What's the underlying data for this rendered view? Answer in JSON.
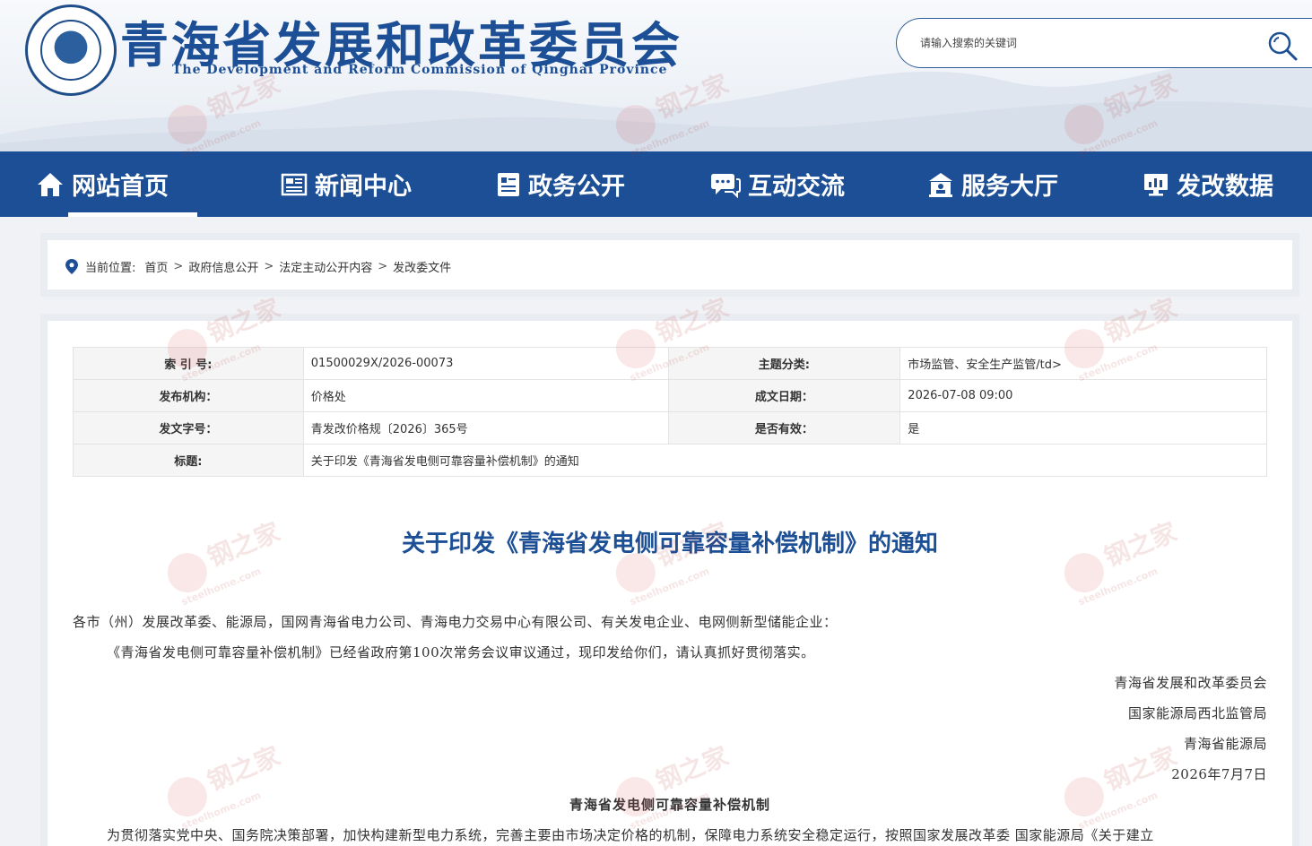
{
  "header": {
    "title": "青海省发展和改革委员会",
    "subtitle": "The Development and Reform Commission of Qinghai Province",
    "search_placeholder": "请输入搜索的关键词"
  },
  "nav": {
    "items": [
      {
        "label": "网站首页",
        "icon": "home-icon"
      },
      {
        "label": "新闻中心",
        "icon": "news-icon"
      },
      {
        "label": "政务公开",
        "icon": "document-icon"
      },
      {
        "label": "互动交流",
        "icon": "chat-icon"
      },
      {
        "label": "服务大厅",
        "icon": "service-icon"
      },
      {
        "label": "发改数据",
        "icon": "data-icon"
      }
    ],
    "active": "网站首页"
  },
  "breadcrumb": {
    "prefix": "当前位置:",
    "items": [
      "首页",
      "政府信息公开",
      "法定主动公开内容",
      "发改委文件"
    ],
    "separator": ">"
  },
  "meta": {
    "index_label": "索 引 号:",
    "index_value": "01500029X/2026-00073",
    "topic_label": "主题分类:",
    "topic_value": "市场监管、安全生产监管/td>",
    "org_label": "发布机构：",
    "org_value": "价格处",
    "date_label": "成文日期：",
    "date_value": "2026-07-08 09:00",
    "docno_label": "发文字号：",
    "docno_value": "青发改价格规〔2026〕365号",
    "valid_label": "是否有效：",
    "valid_value": "是",
    "title_label": "标题:",
    "title_value": "关于印发《青海省发电侧可靠容量补偿机制》的通知"
  },
  "document": {
    "title": "关于印发《青海省发电侧可靠容量补偿机制》的通知",
    "addressee": "各市（州）发展改革委、能源局，国网青海省电力公司、青海电力交易中心有限公司、有关发电企业、电网侧新型储能企业：",
    "body": "《青海省发电侧可靠容量补偿机制》已经省政府第100次常务会议审议通过，现印发给你们，请认真抓好贯彻落实。",
    "signers": [
      "青海省发展和改革委员会",
      "国家能源局西北监管局",
      "青海省能源局"
    ],
    "sign_date": "2026年7月7日",
    "section_title": "青海省发电侧可靠容量补偿机制",
    "section_para": "为贯彻落实党中央、国务院决策部署，加快构建新型电力系统，完善主要由市场决定价格的机制，保障电力系统安全稳定运行，按照国家发展改革委 国家能源局《关于建立"
  },
  "watermark": {
    "cn": "钢之家",
    "en": "steelhome.com"
  },
  "colors": {
    "brand": "#1c4f95",
    "title": "#1c4f95"
  }
}
